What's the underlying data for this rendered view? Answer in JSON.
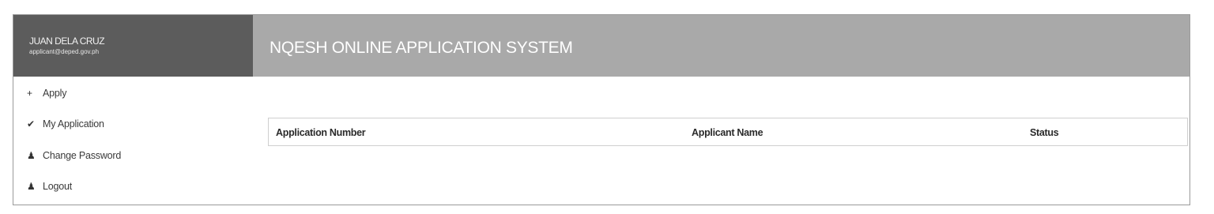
{
  "user": {
    "name": "JUAN DELA CRUZ",
    "email": "applicant@deped.gov.ph"
  },
  "header": {
    "title": "NQESH ONLINE APPLICATION SYSTEM"
  },
  "sidebar": {
    "items": [
      {
        "label": "Apply",
        "icon": "plus-icon",
        "glyph": "+"
      },
      {
        "label": "My Application",
        "icon": "checkmark-icon",
        "glyph": "✔"
      },
      {
        "label": "Change Password",
        "icon": "user-icon",
        "glyph": "♟"
      },
      {
        "label": "Logout",
        "icon": "user-icon",
        "glyph": "♟"
      }
    ]
  },
  "table": {
    "columns": [
      "Application Number",
      "Applicant Name",
      "Status"
    ],
    "rows": []
  },
  "colors": {
    "user_box_bg": "#5c5c5c",
    "header_bg": "#a9a9a9"
  }
}
